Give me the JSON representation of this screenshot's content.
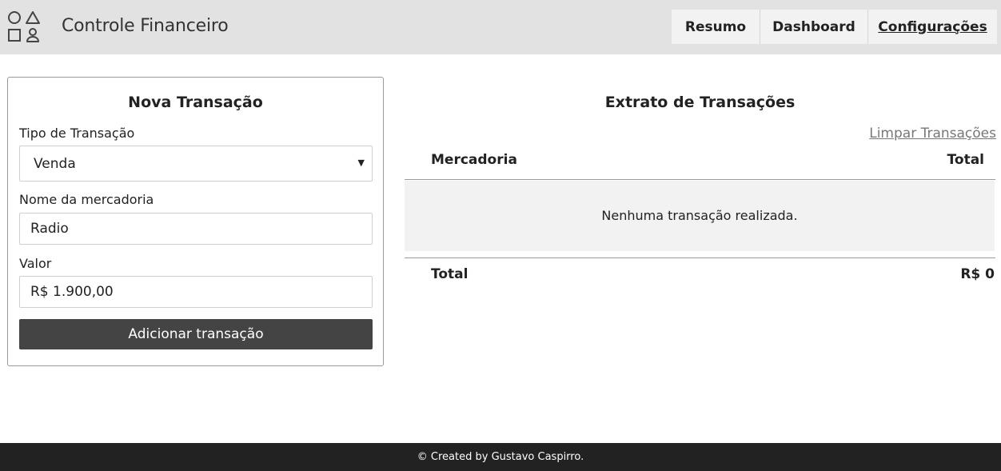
{
  "header": {
    "app_title": "Controle Financeiro",
    "logo_icon": "shapes-icon",
    "nav": [
      {
        "label": "Resumo"
      },
      {
        "label": "Dashboard"
      },
      {
        "label": "Configurações"
      }
    ]
  },
  "form": {
    "title": "Nova Transação",
    "type_label": "Tipo de Transação",
    "type_value": "Venda",
    "name_label": "Nome da mercadoria",
    "name_value": "Radio",
    "value_label": "Valor",
    "value_value": "R$ 1.900,00",
    "submit_label": "Adicionar transação"
  },
  "extract": {
    "title": "Extrato de Transações",
    "clear_link": "Limpar Transações",
    "col_merchandise": "Mercadoria",
    "col_total": "Total",
    "empty_message": "Nenhuma transação realizada.",
    "footer_label": "Total",
    "footer_value": "R$ 0"
  },
  "footer": {
    "text": "© Created by Gustavo Caspirro."
  },
  "colors": {
    "header_bg": "#e2e2e2",
    "button_bg": "#444444",
    "footer_bg": "#222222",
    "empty_row_bg": "#f1f2f1"
  }
}
